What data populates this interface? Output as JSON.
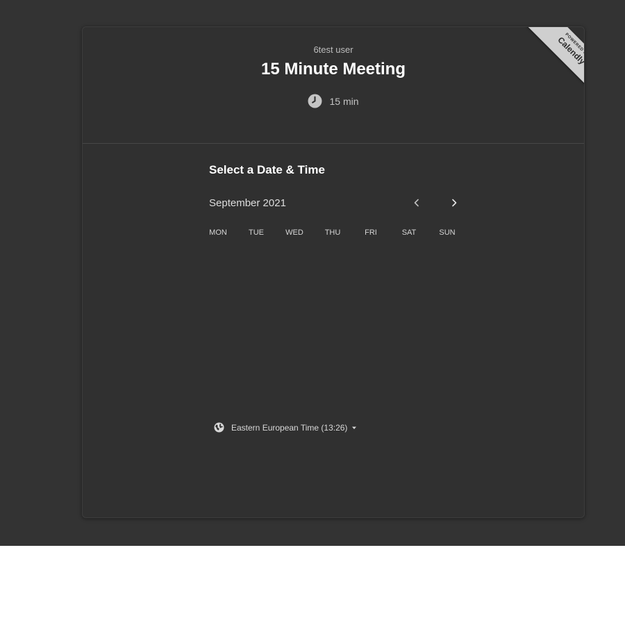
{
  "header": {
    "host_name": "6test user",
    "event_title": "15 Minute Meeting",
    "duration": "15 min"
  },
  "branding": {
    "powered_by": "POWERED BY",
    "brand": "Calendly"
  },
  "calendar": {
    "section_title": "Select a Date & Time",
    "month": "September 2021",
    "prev_icon": "chevron-left-icon",
    "next_icon": "chevron-right-icon",
    "weekdays": [
      "MON",
      "TUE",
      "WED",
      "THU",
      "FRI",
      "SAT",
      "SUN"
    ]
  },
  "timezone": {
    "label": "Eastern European Time (13:26)",
    "icon": "globe-icon"
  },
  "colors": {
    "page_background": "#333333",
    "card_background": "#303030",
    "ribbon": "#cfcfcf"
  }
}
